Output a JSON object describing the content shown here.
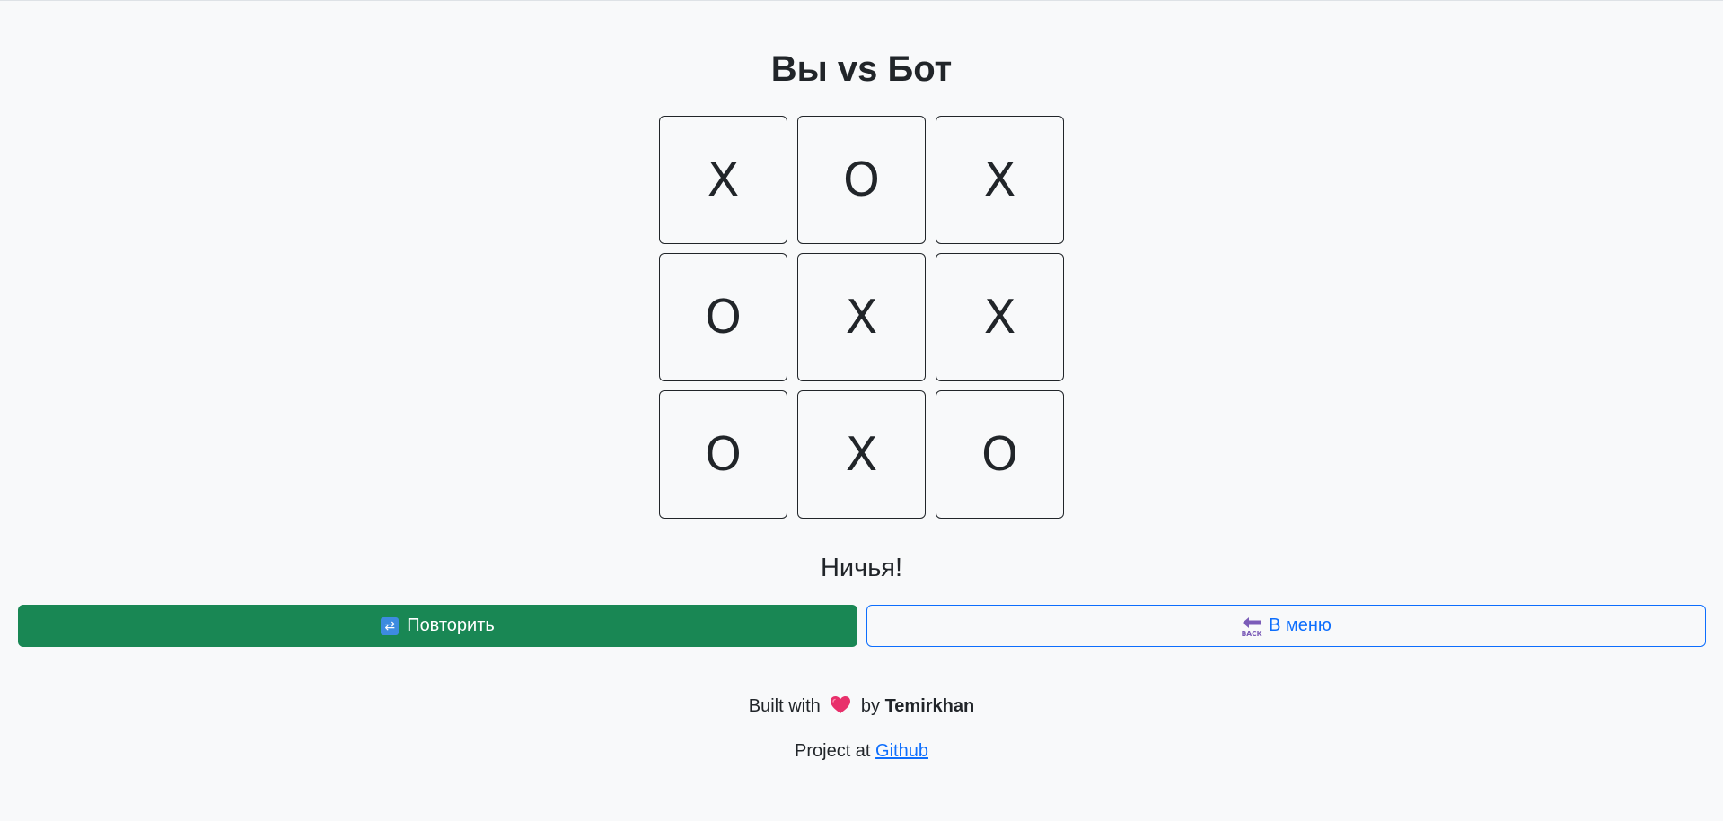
{
  "header": {
    "title": "Вы vs Бот"
  },
  "board": {
    "cells": [
      "X",
      "O",
      "X",
      "O",
      "X",
      "X",
      "O",
      "X",
      "O"
    ]
  },
  "status": {
    "text": "Ничья!"
  },
  "actions": {
    "retry_label": "Повторить",
    "retry_icon": "repeat-icon",
    "menu_label": "В меню",
    "menu_icon": "back-arrow-icon",
    "retry_color": "#198754",
    "menu_color": "#0d6efd"
  },
  "footer": {
    "built_prefix": "Built with",
    "built_icon": "heart-icon",
    "built_by": "by",
    "author": "Temirkhan",
    "project_prefix": "Project at",
    "project_link": "Github"
  }
}
